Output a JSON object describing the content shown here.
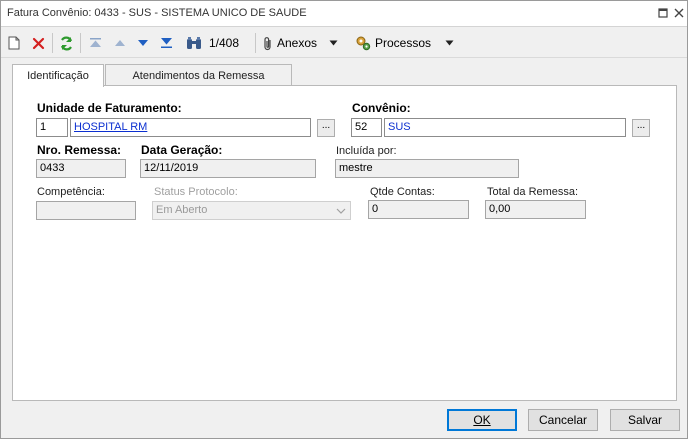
{
  "window": {
    "title": "Fatura Convênio: 0433 - SUS - SISTEMA UNICO DE SAUDE"
  },
  "toolbar": {
    "record_position": "1/408",
    "attachments_label": "Anexos",
    "processes_label": "Processos"
  },
  "tabs": [
    {
      "label": "Identificação",
      "active": true
    },
    {
      "label": "Atendimentos da Remessa",
      "active": false
    }
  ],
  "form": {
    "unidade_label": "Unidade de Faturamento:",
    "unidade_code": "1",
    "unidade_name": "HOSPITAL RM",
    "convenio_label": "Convênio:",
    "convenio_code": "52",
    "convenio_name": "SUS",
    "ellipsis": "...",
    "nro_remessa_label": "Nro. Remessa:",
    "nro_remessa_value": "0433",
    "data_geracao_label": "Data Geração:",
    "data_geracao_value": "12/11/2019",
    "incluida_por_label": "Incluída por:",
    "incluida_por_value": "mestre",
    "competencia_label": "Competência:",
    "competencia_value": "",
    "status_protocolo_label": "Status Protocolo:",
    "status_protocolo_value": "Em Aberto",
    "qtde_contas_label": "Qtde Contas:",
    "qtde_contas_value": "0",
    "total_remessa_label": "Total da Remessa:",
    "total_remessa_value": "0,00"
  },
  "footer": {
    "ok_label": "OK",
    "cancel_label": "Cancelar",
    "save_label": "Salvar"
  },
  "colors": {
    "link_blue": "#0b2fd0",
    "refresh_green": "#2e9a2e",
    "delete_red": "#d42020",
    "nav_blue": "#1f5fc2"
  }
}
